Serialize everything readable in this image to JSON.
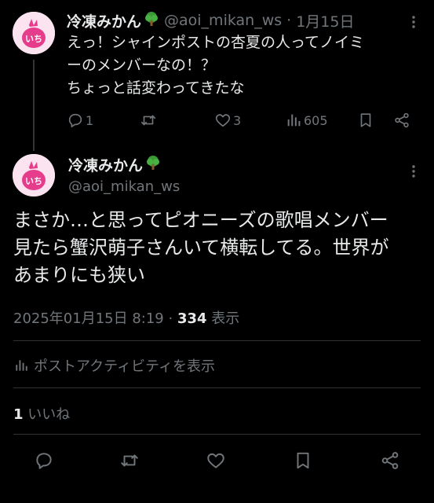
{
  "reply": {
    "name": "冷凍みかん",
    "handle": "@aoi_mikan_ws",
    "separator": "·",
    "date": "1月15日",
    "lines": [
      "えっ！シャインポストの杏夏の人ってノイミ",
      "ーのメンバーなの！？",
      "ちょっと話変わってきたな"
    ],
    "reply_count": "1",
    "like_count": "3",
    "view_count": "605"
  },
  "main": {
    "name": "冷凍みかん",
    "handle": "@aoi_mikan_ws",
    "lines": [
      "まさか…と思ってピオニーズの歌唱メンバー",
      "見たら蟹沢萌子さんいて横転してる。世界が",
      "あまりにも狭い"
    ],
    "timestamp": "2025年01月15日 8:19",
    "meta_separator": " · ",
    "views": "334",
    "views_label": " 表示",
    "activity_label": "ポストアクティビティを表示",
    "likes_count": "1",
    "likes_label": " いいね"
  },
  "icons": {
    "name_emoji": "tree-icon",
    "reply": "reply-icon",
    "repost": "repost-icon",
    "like": "heart-icon",
    "views": "views-icon",
    "bookmark": "bookmark-icon",
    "share": "share-icon",
    "more": "more-icon"
  },
  "colors": {
    "background": "#000000",
    "text": "#e7e9ea",
    "muted": "#71767b",
    "divider": "#2f3336",
    "avatar_bg": "#fbe3ef",
    "avatar_accent": "#e63c8c"
  }
}
